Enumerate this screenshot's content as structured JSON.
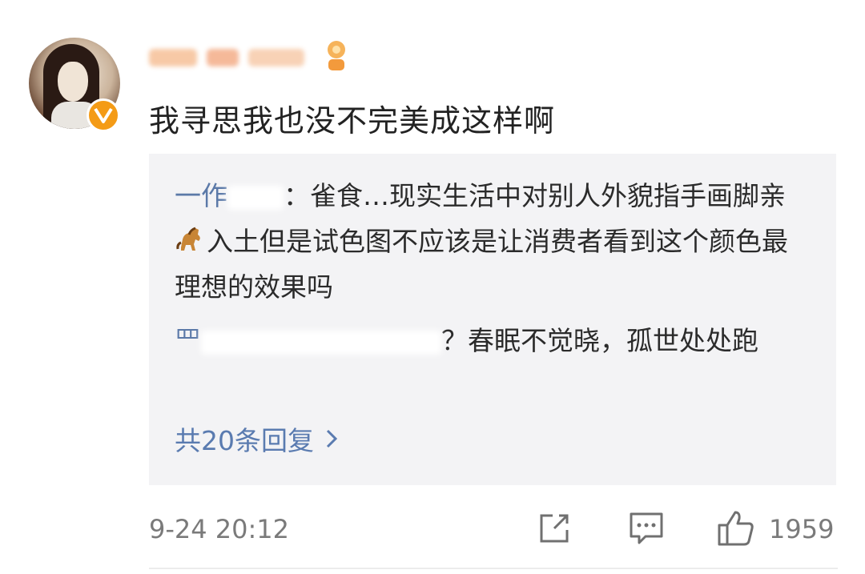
{
  "comment": {
    "author_badge": "verified-v",
    "text": "我寻思我也没不完美成这样啊",
    "timestamp": "9-24 20:12",
    "like_count": "1959"
  },
  "replies": [
    {
      "name_visible_fragment": "一作",
      "text_before_icon": "：雀食…现实生活中对别人外貌指手画脚亲",
      "icon": "horse-emoji",
      "text_after_icon": "入土但是试色图不应该是让消费者看到这个颜色最理想的效果吗"
    },
    {
      "name_visible_fragment": "罒",
      "text": "？春眠不觉晓，孤世处处跑"
    }
  ],
  "more_replies_label": "共20条回复",
  "colors": {
    "link_blue": "#5a7bb0",
    "badge_orange": "#f49b16",
    "reply_bg": "#f3f3f5"
  },
  "icons": [
    "share-icon",
    "comment-icon",
    "thumbs-up-icon",
    "chevron-right-icon"
  ]
}
